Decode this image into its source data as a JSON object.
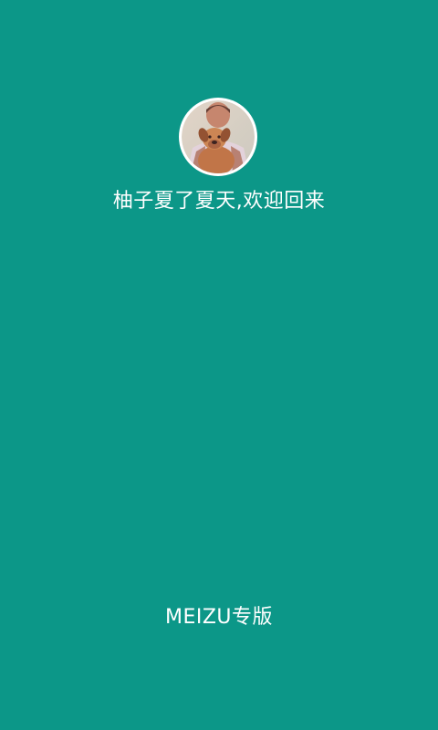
{
  "splash": {
    "avatar_icon": "user-photo-with-dog",
    "welcome_text": "柚子夏了夏天,欢迎回来",
    "edition_label": "MEIZU专版"
  },
  "colors": {
    "background": "#0c9788",
    "text": "#ffffff",
    "avatar_ring": "#ffffff"
  }
}
